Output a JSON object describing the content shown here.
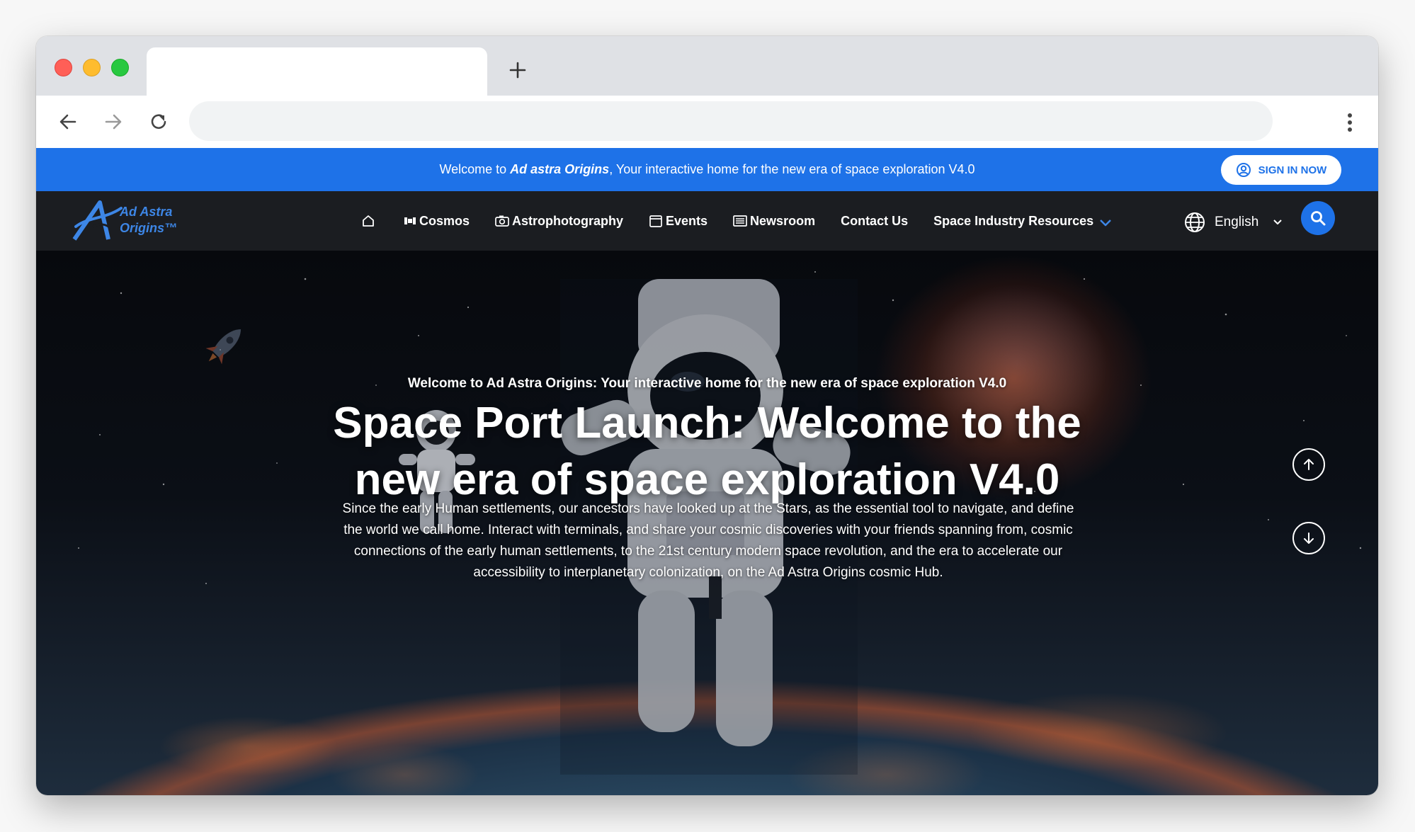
{
  "browser": {
    "new_tab_icon": "plus-icon",
    "back_icon": "arrow-left-icon",
    "forward_icon": "arrow-right-icon",
    "reload_icon": "reload-icon",
    "menu_icon": "kebab-menu-icon",
    "address": ""
  },
  "announcement": {
    "prefix": "Welcome to ",
    "brand": "Ad astra Origins",
    "suffix": ", Your interactive home for the new era of space exploration V4.0",
    "signin_label": "SIGN IN NOW"
  },
  "nav": {
    "logo_line1": "Ad Astra",
    "logo_line2": "Origins™",
    "items": [
      {
        "label": "",
        "icon": "home-icon"
      },
      {
        "label": "Cosmos",
        "icon": "satellite-icon"
      },
      {
        "label": "Astrophotography",
        "icon": "camera-icon"
      },
      {
        "label": "Events",
        "icon": "calendar-icon"
      },
      {
        "label": "Newsroom",
        "icon": "newspaper-icon"
      },
      {
        "label": "Contact Us",
        "icon": ""
      },
      {
        "label": "Space Industry Resources",
        "icon": "chevron-down-icon"
      }
    ],
    "language": "English"
  },
  "hero": {
    "kicker": "Welcome to Ad Astra Origins: Your interactive home for the new era of space exploration V4.0",
    "headline": "Space Port Launch: Welcome to the new era of space exploration V4.0",
    "description": "Since the early Human settlements, our ancestors have looked up at the Stars, as the essential tool to navigate, and define the world we call home. Interact with terminals, and share your cosmic discoveries with your friends spanning from, cosmic connections of the early human settlements, to the 21st century modern space revolution, and the era to accelerate our accessibility to interplanetary colonization, on the Ad Astra Origins cosmic Hub."
  },
  "colors": {
    "accent": "#1e72e8",
    "nav_background": "#1b1d21",
    "logo_blue": "#3d86e6"
  }
}
